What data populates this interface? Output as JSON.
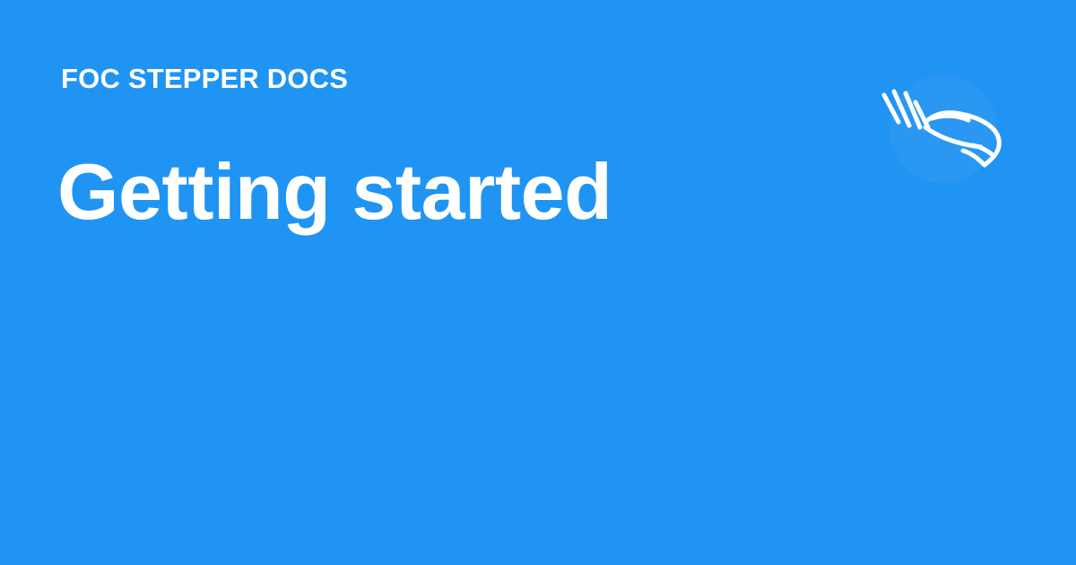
{
  "header": {
    "site_name": "FOC STEPPER DOCS",
    "logo_icon": "hand-icon"
  },
  "main": {
    "title": "Getting started"
  },
  "colors": {
    "background": "#2094F3",
    "foreground": "#FFFFFF"
  }
}
